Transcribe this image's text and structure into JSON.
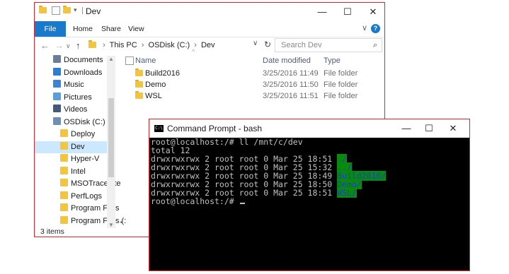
{
  "explorer": {
    "title": "Dev",
    "window_controls": {
      "minimize": "—",
      "maximize": "☐",
      "close": "✕"
    },
    "ribbon_tabs": [
      "File",
      "Home",
      "Share",
      "View"
    ],
    "help": "?",
    "address": {
      "crumbs": [
        "This PC",
        "OSDisk (C:)",
        "Dev"
      ],
      "search_placeholder": "Search Dev"
    },
    "nav_items": [
      {
        "label": "Documents",
        "icon": "documents-icon",
        "color": "#6b7d99"
      },
      {
        "label": "Downloads",
        "icon": "downloads-icon",
        "color": "#2a7ed3"
      },
      {
        "label": "Music",
        "icon": "music-icon",
        "color": "#3b86d4"
      },
      {
        "label": "Pictures",
        "icon": "pictures-icon",
        "color": "#5a9fd6"
      },
      {
        "label": "Videos",
        "icon": "videos-icon",
        "color": "#445a7d"
      },
      {
        "label": "OSDisk (C:)",
        "icon": "drive-icon",
        "color": "#6d8fb5"
      },
      {
        "label": "Deploy",
        "icon": "folder-icon",
        "color": "#f2c53d"
      },
      {
        "label": "Dev",
        "icon": "folder-icon",
        "color": "#f2c53d",
        "selected": true
      },
      {
        "label": "Hyper-V",
        "icon": "folder-icon",
        "color": "#f2c53d"
      },
      {
        "label": "Intel",
        "icon": "folder-icon",
        "color": "#f2c53d"
      },
      {
        "label": "MSOTraceLite",
        "icon": "folder-icon",
        "color": "#f2c53d"
      },
      {
        "label": "PerfLogs",
        "icon": "folder-icon",
        "color": "#f2c53d"
      },
      {
        "label": "Program Files",
        "icon": "folder-icon",
        "color": "#f2c53d"
      },
      {
        "label": "Program Files (:",
        "icon": "folder-icon",
        "color": "#f2c53d"
      }
    ],
    "columns": {
      "name": "Name",
      "date": "Date modified",
      "type": "Type"
    },
    "files": [
      {
        "name": "Build2016",
        "date": "3/25/2016 11:49",
        "type": "File folder"
      },
      {
        "name": "Demo",
        "date": "3/25/2016 11:50",
        "type": "File folder"
      },
      {
        "name": "WSL",
        "date": "3/25/2016 11:51",
        "type": "File folder"
      }
    ],
    "status": "3 items"
  },
  "cmd": {
    "title": "Command Prompt - bash",
    "icon_text": "C:\\",
    "window_controls": {
      "minimize": "—",
      "maximize": "☐",
      "close": "✕"
    },
    "lines": [
      {
        "text": "root@localhost:/# ll /mnt/c/dev"
      },
      {
        "text": "total 12"
      },
      {
        "text": "drwxrwxrwx 2 root root 0 Mar 25 18:51 ",
        "hl": "./"
      },
      {
        "text": "drwxrwxrwx 2 root root 0 Mar 25 15:32 ",
        "hl": "../"
      },
      {
        "text": "drwxrwxrwx 2 root root 0 Mar 25 18:49 ",
        "hl": "Build2016/"
      },
      {
        "text": "drwxrwxrwx 2 root root 0 Mar 25 18:50 ",
        "hl": "Demo/"
      },
      {
        "text": "drwxrwxrwx 2 root root 0 Mar 25 18:51 ",
        "hl": "WSL/"
      },
      {
        "text": "root@localhost:/# ",
        "cursor": true
      }
    ],
    "colors": {
      "background": "#000000",
      "text": "#c0c0c0",
      "dir_highlight_bg": "#0a8a0a",
      "dir_highlight_fg": "#1d3bd6"
    }
  },
  "colors": {
    "window_border": "#d8262b",
    "accent": "#1979ca",
    "selection": "#cce8ff",
    "folder": "#f2c53d"
  }
}
